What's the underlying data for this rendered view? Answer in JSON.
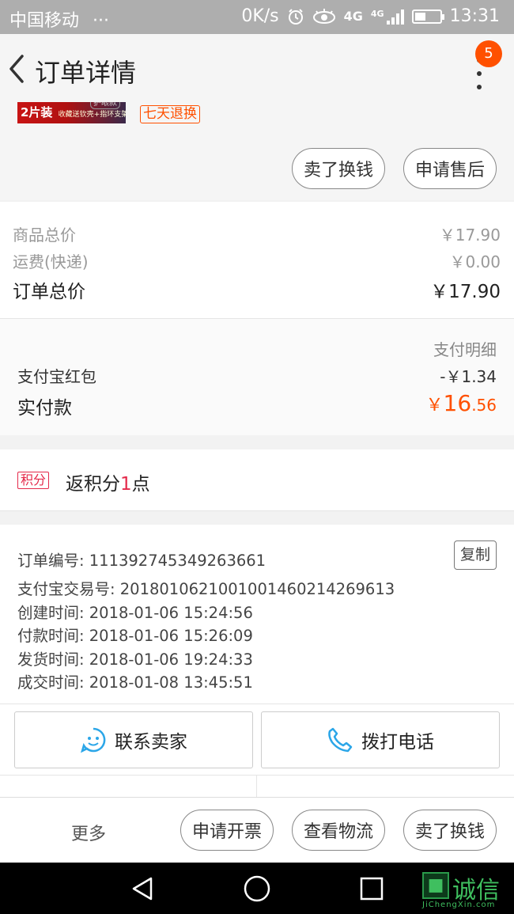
{
  "status_bar": {
    "carrier": "中国移动",
    "dots": "···",
    "speed": "0K/s",
    "network": "4G",
    "network2": "4G",
    "time": "13:31"
  },
  "header": {
    "title": "订单详情",
    "badge_count": "5",
    "product_tag_main": "2片装",
    "product_tag_mid": "护眼款",
    "product_tag_sub": "收藏送钦壳+指环支架",
    "return_tag": "七天退换",
    "sell_button": "卖了换钱",
    "aftersale_button": "申请售后"
  },
  "prices": {
    "goods_label": "商品总价",
    "goods_value": "￥17.90",
    "shipping_label": "运费(快递)",
    "shipping_value": "￥0.00",
    "total_label": "订单总价",
    "total_value": "￥17.90"
  },
  "payment": {
    "detail_link": "支付明细",
    "redpacket_label": "支付宝红包",
    "redpacket_value": "-￥1.34",
    "paid_label": "实付款",
    "paid_symbol": "￥",
    "paid_int": "16",
    "paid_dec": ".56"
  },
  "points": {
    "tag": "积分",
    "text_pre": "返积分",
    "number": "1",
    "text_post": "点"
  },
  "order_info": {
    "order_no": "订单编号: 111392745349263661",
    "copy_button": "复制",
    "alipay_no": "支付宝交易号: 2018010621001001460214269613",
    "created": "创建时间: 2018-01-06 15:24:56",
    "paid": "付款时间: 2018-01-06 15:26:09",
    "shipped": "发货时间: 2018-01-06 19:24:33",
    "completed": "成交时间: 2018-01-08 13:45:51"
  },
  "actions": {
    "contact_seller": "联系卖家",
    "call_phone": "拨打电话"
  },
  "bottom_bar": {
    "more": "更多",
    "invoice": "申请开票",
    "logistics": "查看物流",
    "sell": "卖了换钱"
  },
  "watermark": {
    "cn": "诚信",
    "en": "JiChengXin.com"
  },
  "colors": {
    "accent": "#ff5000",
    "points_red": "#e4294a",
    "status_bar": "#aeaeae",
    "nav_bar": "#000000",
    "phone_blue": "#2ba6e8"
  },
  "icons": [
    "back-arrow-icon",
    "more-dots-icon",
    "alarm-icon",
    "eye-icon",
    "signal-icon",
    "battery-icon",
    "smile-chat-icon",
    "phone-icon",
    "nav-back-icon",
    "nav-home-icon",
    "nav-recent-icon"
  ]
}
